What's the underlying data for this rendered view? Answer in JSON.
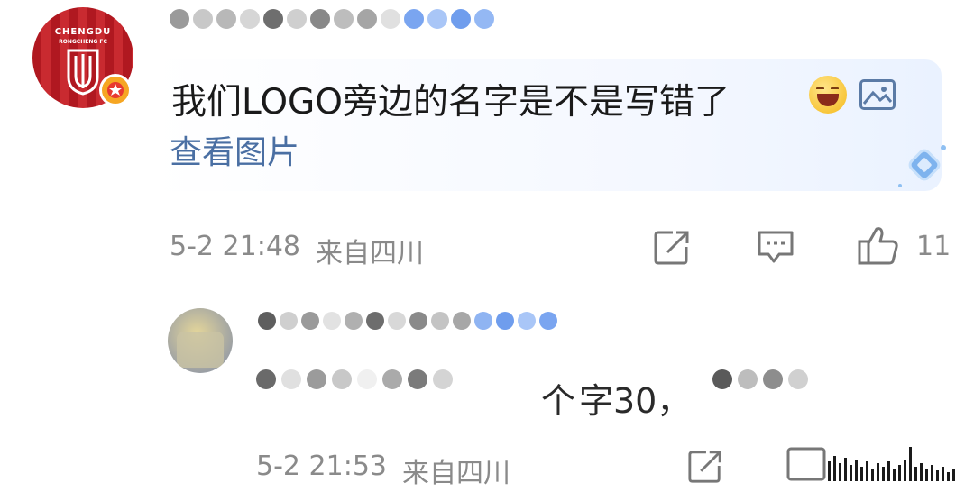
{
  "comment": {
    "avatar": {
      "logo_line1": "CHENGDU",
      "logo_line2": "RONGCHENG FC",
      "badge_icon": "star-badge-icon",
      "accent": "#b01820"
    },
    "text": "我们LOGO旁边的名字是不是写错了",
    "emoji": "laughing-emoji",
    "image_icon": "image-icon",
    "view_image_label": "查看图片",
    "timestamp": "5-2 21:48",
    "location": "来自四川",
    "like_count": "11"
  },
  "reply": {
    "visible_fragment_1": "个",
    "visible_fragment_2": "字30，",
    "timestamp": "5-2 21:53",
    "location": "来自四川"
  },
  "colors": {
    "link_blue": "#4a6fa3",
    "meta_gray": "#8a8a8a",
    "text_dark": "#1a1a1a"
  }
}
